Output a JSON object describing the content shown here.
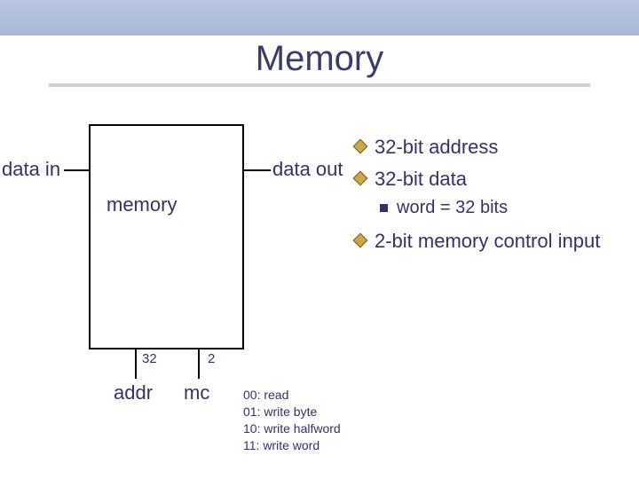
{
  "title": "Memory",
  "diagram": {
    "box_label": "memory",
    "data_in": "data in",
    "data_out": "data out",
    "addr_line_width": "32",
    "addr_label": "addr",
    "mc_line_width": "2",
    "mc_label": "mc"
  },
  "bullets": {
    "b1": "32-bit address",
    "b2": "32-bit data",
    "b2s": "word = 32 bits",
    "b3": "2-bit memory control input"
  },
  "codes": {
    "c1": "00: read",
    "c2": "01: write byte",
    "c3": "10: write halfword",
    "c4": "11: write word"
  }
}
